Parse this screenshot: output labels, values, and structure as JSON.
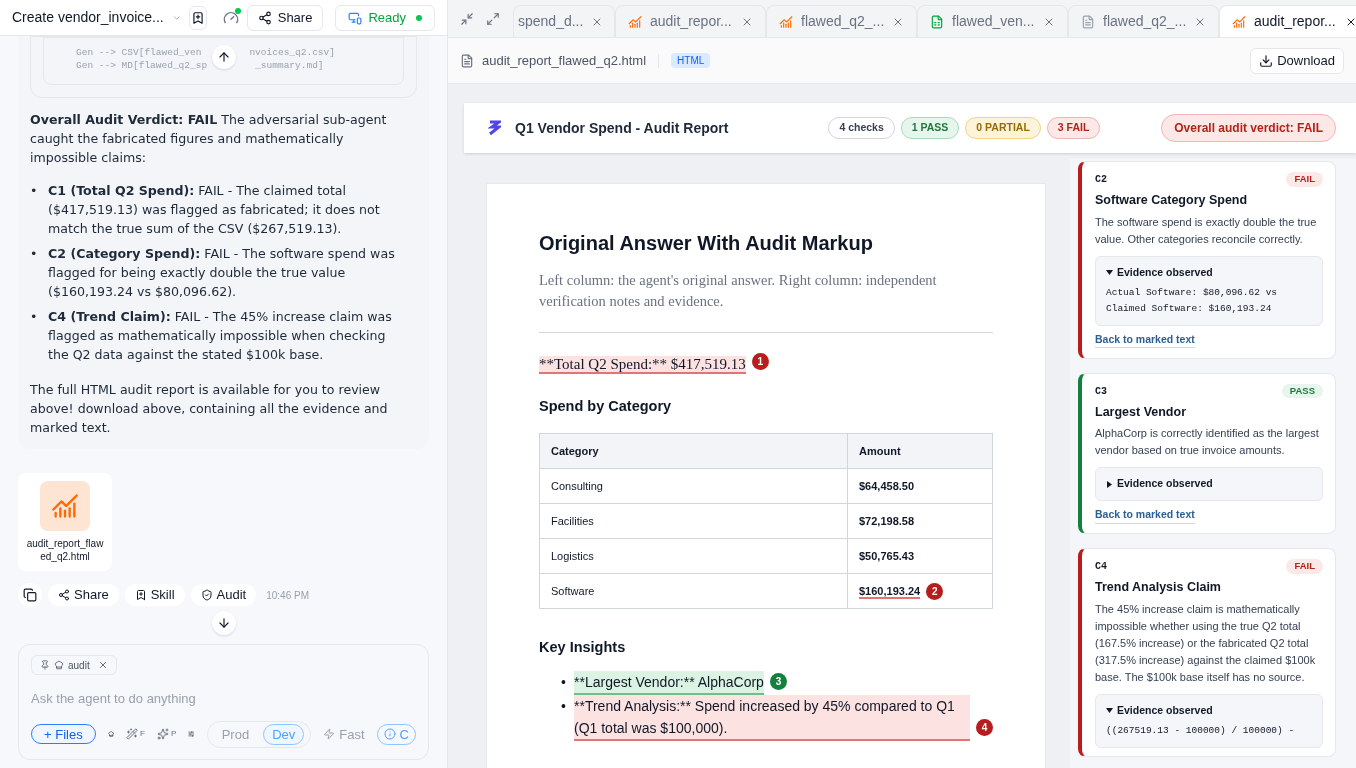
{
  "header": {
    "title": "Create vendor_invoice...",
    "share": "Share",
    "status": "Ready"
  },
  "chat": {
    "code_lines": [
      {
        "left": "Gen --> CSV[flawed_ven",
        "right": "nvoices_q2.csv]"
      },
      {
        "left": "Gen --> MD[flawed_q2_sp",
        "right": "_summary.md]"
      }
    ],
    "verdict": "**Overall Audit Verdict: FAIL** The adversarial sub-agent caught the fabricated figures and mathematically impossible claims:",
    "bullets": [
      {
        "marker": "•",
        "text": "**C1 (Total Q2 Spend):** FAIL - The claimed total ($417,519.13) was flagged as fabricated; it does not match the true sum of the CSV ($267,519.13)."
      },
      {
        "marker": "•",
        "text": "**C2 (Category Spend):** FAIL - The software spend was flagged for being exactly double the true value ($160,193.24 vs $80,096.62)."
      },
      {
        "marker": "•",
        "text": "**C4 (Trend Claim):** FAIL - The 45% increase claim was flagged as mathematically impossible when checking the Q2 data against the stated $100k base."
      }
    ],
    "closing": "The full HTML audit report is available for you to review above! download above, containing all the evidence and marked text.",
    "attachment": "audit_report_flawed_q2.html",
    "actions": [
      "Share",
      "Skill",
      "Audit"
    ],
    "time": "10:46 PM"
  },
  "composer": {
    "chip": "audit",
    "placeholder": "Ask the agent to do anything",
    "files": "+ Files",
    "tools": [
      "F",
      "P"
    ],
    "modes": [
      {
        "label": "Prod",
        "selected": false
      },
      {
        "label": "Dev",
        "selected": true
      }
    ],
    "speed": "Fast",
    "cut_chip": "C"
  },
  "tabs": [
    {
      "label": "spend_d...",
      "kind": "plain",
      "selected": false
    },
    {
      "label": "audit_repor...",
      "kind": "chart",
      "selected": false
    },
    {
      "label": "flawed_q2_...",
      "kind": "chart",
      "selected": false
    },
    {
      "label": "flawed_ven...",
      "kind": "sheet",
      "selected": false
    },
    {
      "label": "flawed_q2_...",
      "kind": "doc",
      "selected": false
    },
    {
      "label": "audit_repor...",
      "kind": "chart",
      "selected": true
    }
  ],
  "file_bar": {
    "name": "audit_report_flawed_q2.html",
    "badge": "HTML",
    "download": "Download"
  },
  "report": {
    "title": "Q1 Vendor Spend - Audit Report",
    "badges": [
      {
        "label": "4 checks",
        "kind": "neutral"
      },
      {
        "label": "1 PASS",
        "kind": "pass"
      },
      {
        "label": "0 PARTIAL",
        "kind": "partial"
      },
      {
        "label": "3 FAIL",
        "kind": "fail"
      }
    ],
    "verdict": "Overall audit verdict: FAIL"
  },
  "document": {
    "title": "Original Answer With Audit Markup",
    "subtitle": "Left column: the agent's original answer. Right column: independent verification notes and evidence.",
    "total": {
      "text": "**Total Q2 Spend:** $417,519.13",
      "mark": "1",
      "kind": "fail"
    },
    "section": "Spend by Category",
    "table": {
      "columns": [
        "Category",
        "Amount"
      ],
      "rows": [
        {
          "category": "Consulting",
          "amount": "$64,458.50"
        },
        {
          "category": "Facilities",
          "amount": "$72,198.58"
        },
        {
          "category": "Logistics",
          "amount": "$50,765.43"
        },
        {
          "category": "Software",
          "amount": "$160,193.24",
          "mark": "2",
          "kind": "fail"
        }
      ]
    },
    "insights_title": "Key Insights",
    "insights": [
      {
        "marker": "•",
        "text": "**Largest Vendor:** AlphaCorp",
        "mark": "3",
        "kind": "pass"
      },
      {
        "marker": "•",
        "text": "**Trend Analysis:** Spend increased by 45% compared to Q1 (Q1 total was $100,000).",
        "mark": "4",
        "kind": "fail"
      }
    ]
  },
  "cards": [
    {
      "id": "C2",
      "kind": "fail",
      "status_label": "FAIL",
      "title": "Software Category Spend",
      "body": "The software spend is exactly double the true value. Other categories reconcile correctly.",
      "evidence_label": "Evidence observed",
      "expanded": true,
      "evidence": [
        "Actual Software: $80,096.62 vs",
        "Claimed Software: $160,193.24"
      ],
      "link": "Back to marked text"
    },
    {
      "id": "C3",
      "kind": "pass",
      "status_label": "PASS",
      "title": "Largest Vendor",
      "body": "AlphaCorp is correctly identified as the largest vendor based on true invoice amounts.",
      "evidence_label": "Evidence observed",
      "expanded": false,
      "link": "Back to marked text"
    },
    {
      "id": "C4",
      "kind": "fail",
      "status_label": "FAIL",
      "title": "Trend Analysis Claim",
      "body": "The 45% increase claim is mathematically impossible whether using the true Q2 total (167.5% increase) or the fabricated Q2 total (317.5% increase) against the claimed $100k base. The $100k base itself has no source.",
      "evidence_label": "Evidence observed",
      "expanded": true,
      "evidence": [
        "((267519.13 - 100000) / 100000) -"
      ]
    }
  ]
}
